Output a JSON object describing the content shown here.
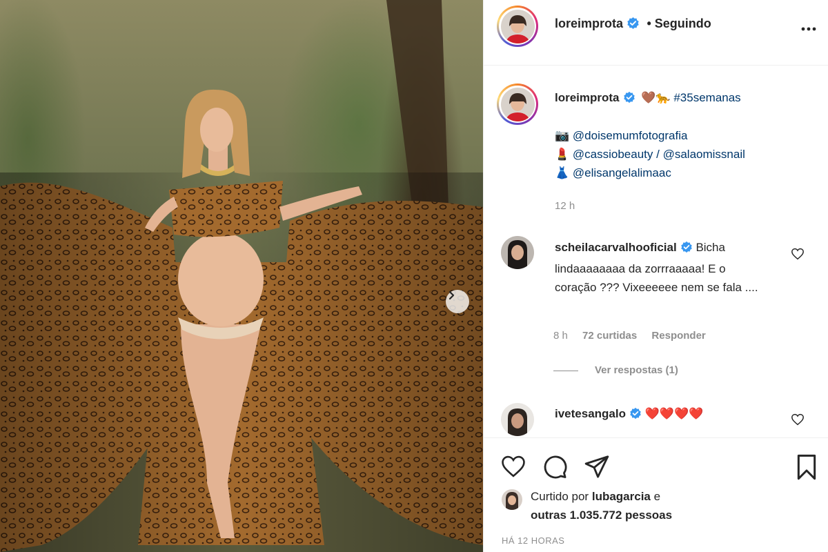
{
  "post_author": {
    "username": "loreimprota",
    "following_label": "• Seguindo",
    "more_icon": "more-horizontal-icon"
  },
  "caption": {
    "username": "loreimprota",
    "emojis": "🤎🐆",
    "hashtag": "#35semanas",
    "credits": [
      {
        "emoji": "📷",
        "handle": "@doisemumfotografia"
      },
      {
        "emoji": "💄",
        "handle": "@cassiobeauty",
        "separator": " / ",
        "handle2": "@salaomissnail"
      },
      {
        "emoji": "👗",
        "handle": "@elisangelalimaac"
      }
    ],
    "time": "12 h"
  },
  "comments": [
    {
      "username": "scheilacarvalhooficial",
      "verified": true,
      "text": "Bicha lindaaaaaaaa da zorrraaaaa! E o coração ??? Vixeeeeee nem se fala ....",
      "time": "8 h",
      "likes": "72 curtidas",
      "reply_label": "Responder",
      "view_replies": "Ver respostas (1)"
    },
    {
      "username": "ivetesangalo",
      "verified": true,
      "text": "❤️❤️❤️❤️"
    }
  ],
  "actions": {
    "like_icon": "heart-outline-icon",
    "comment_icon": "comment-icon",
    "share_icon": "paper-plane-icon",
    "save_icon": "bookmark-icon"
  },
  "liked_by": {
    "prefix": "Curtido por",
    "user": "lubagarcia",
    "connector": "e",
    "others": "outras 1.035.772 pessoas"
  },
  "timestamp": "HÁ 12 HORAS",
  "colors": {
    "link": "#00376b",
    "verified": "#3897f0",
    "muted": "#8e8e8e"
  }
}
